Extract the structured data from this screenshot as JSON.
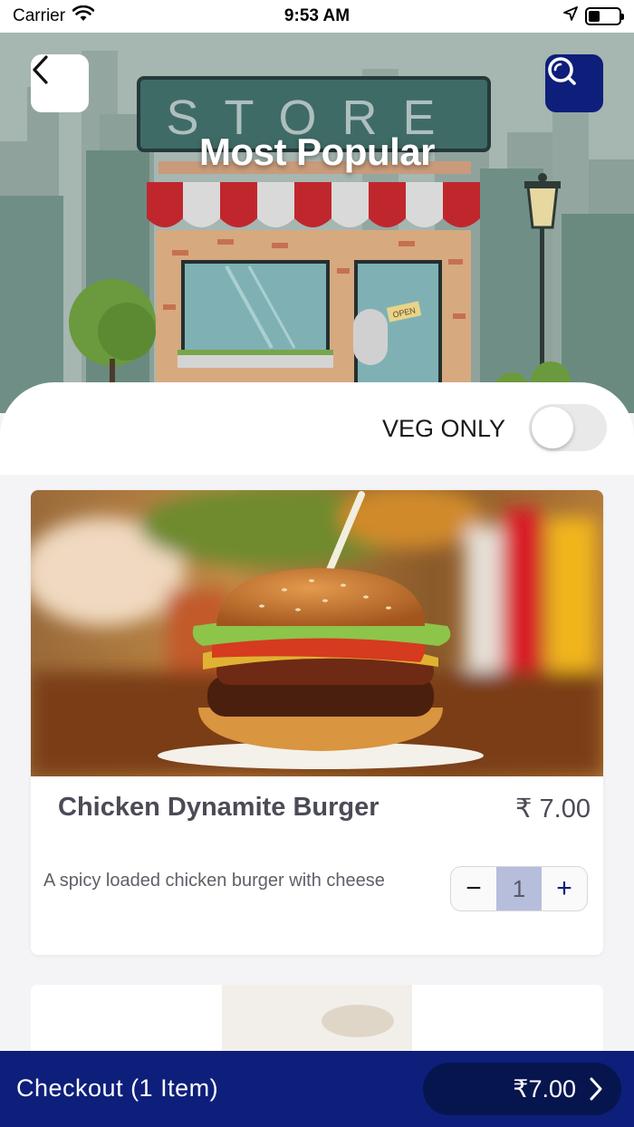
{
  "status_bar": {
    "carrier": "Carrier",
    "time": "9:53 AM"
  },
  "header": {
    "title": "Most Popular",
    "banner_text": "STORE",
    "sign_text": "OPEN"
  },
  "filter": {
    "veg_only_label": "VEG ONLY",
    "veg_only_enabled": false
  },
  "products": [
    {
      "name": "Chicken Dynamite Burger",
      "price": "₹ 7.00",
      "description": "A spicy loaded chicken burger with cheese",
      "quantity": "1",
      "minus_label": "−",
      "plus_label": "+"
    }
  ],
  "checkout": {
    "label": "Checkout (1 Item)",
    "total": "₹7.00"
  },
  "colors": {
    "primary": "#0d1f7a",
    "qty_bg": "#b6bedb",
    "toggle_off": "#e9e9ea"
  },
  "icons": [
    "wifi-icon",
    "location-arrow-icon",
    "battery-icon",
    "back-chevron-icon",
    "search-icon",
    "chevron-right-icon"
  ]
}
